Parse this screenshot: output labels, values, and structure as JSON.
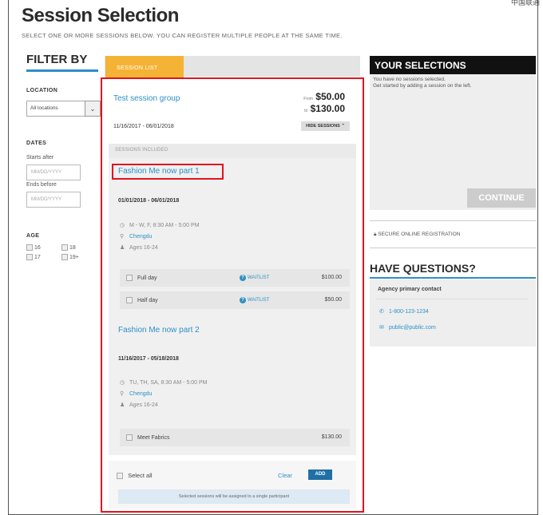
{
  "corner_text": "中国联通",
  "page": {
    "title": "Session Selection",
    "subtitle": "SELECT ONE OR MORE SESSIONS BELOW. YOU CAN REGISTER MULTIPLE PEOPLE AT THE SAME TIME."
  },
  "filter": {
    "heading": "FILTER BY",
    "location_label": "LOCATION",
    "location_value": "All locations",
    "dates_label": "DATES",
    "starts_after_label": "Starts after",
    "starts_after_placeholder": "MM/DD/YYYY",
    "ends_before_label": "Ends before",
    "ends_before_placeholder": "MM/DD/YYYY",
    "age_label": "AGE",
    "ages": [
      "16",
      "18",
      "17",
      "19+"
    ]
  },
  "session_list": {
    "tab_label": "SESSION LIST",
    "group_title": "Test session group",
    "price_from_prefix": "From",
    "price_from": "$50.00",
    "price_to_prefix": "to",
    "price_to": "$130.00",
    "group_dates": "11/16/2017 - 06/01/2018",
    "hide_sessions_label": "HIDE SESSIONS",
    "included_label": "SESSIONS INCLUDED",
    "sessions": [
      {
        "name": "Fashion Me now part 1",
        "dates": "01/01/2018 - 06/01/2018",
        "schedule": "M - W, F, 8:30 AM - 5:00 PM",
        "location": "Chengdu",
        "ages": "Ages 16-24",
        "options": [
          {
            "label": "Full day",
            "waitlist": "WAITLIST",
            "price": "$100.00"
          },
          {
            "label": "Half day",
            "waitlist": "WAITLIST",
            "price": "$50.00"
          }
        ]
      },
      {
        "name": "Fashion Me now part 2",
        "dates": "11/16/2017 - 05/18/2018",
        "schedule": "TU, TH, SA, 8:30 AM - 5:00 PM",
        "location": "Chengdu",
        "ages": "Ages 16-24",
        "options": [
          {
            "label": "Meet Fabrics",
            "price": "$130.00"
          }
        ]
      }
    ],
    "select_all_label": "Select all",
    "clear_label": "Clear",
    "add_label": "ADD",
    "note": "Selected sessions will be assigned to a single participant"
  },
  "selections": {
    "heading": "YOUR SELECTIONS",
    "empty_line1": "You have no sessions selected.",
    "empty_line2": "Get started by adding a session on the left.",
    "continue_label": "CONTINUE"
  },
  "secure_label": "SECURE ONLINE REGISTRATION",
  "questions": {
    "heading": "HAVE QUESTIONS?",
    "contact_title": "Agency primary contact",
    "phone": "1-800-123-1234",
    "email": "public@public.com"
  },
  "colors": {
    "accent": "#2c8fc6",
    "tab": "#f4b334",
    "highlight": "#e0141e",
    "button": "#1f70a6"
  }
}
